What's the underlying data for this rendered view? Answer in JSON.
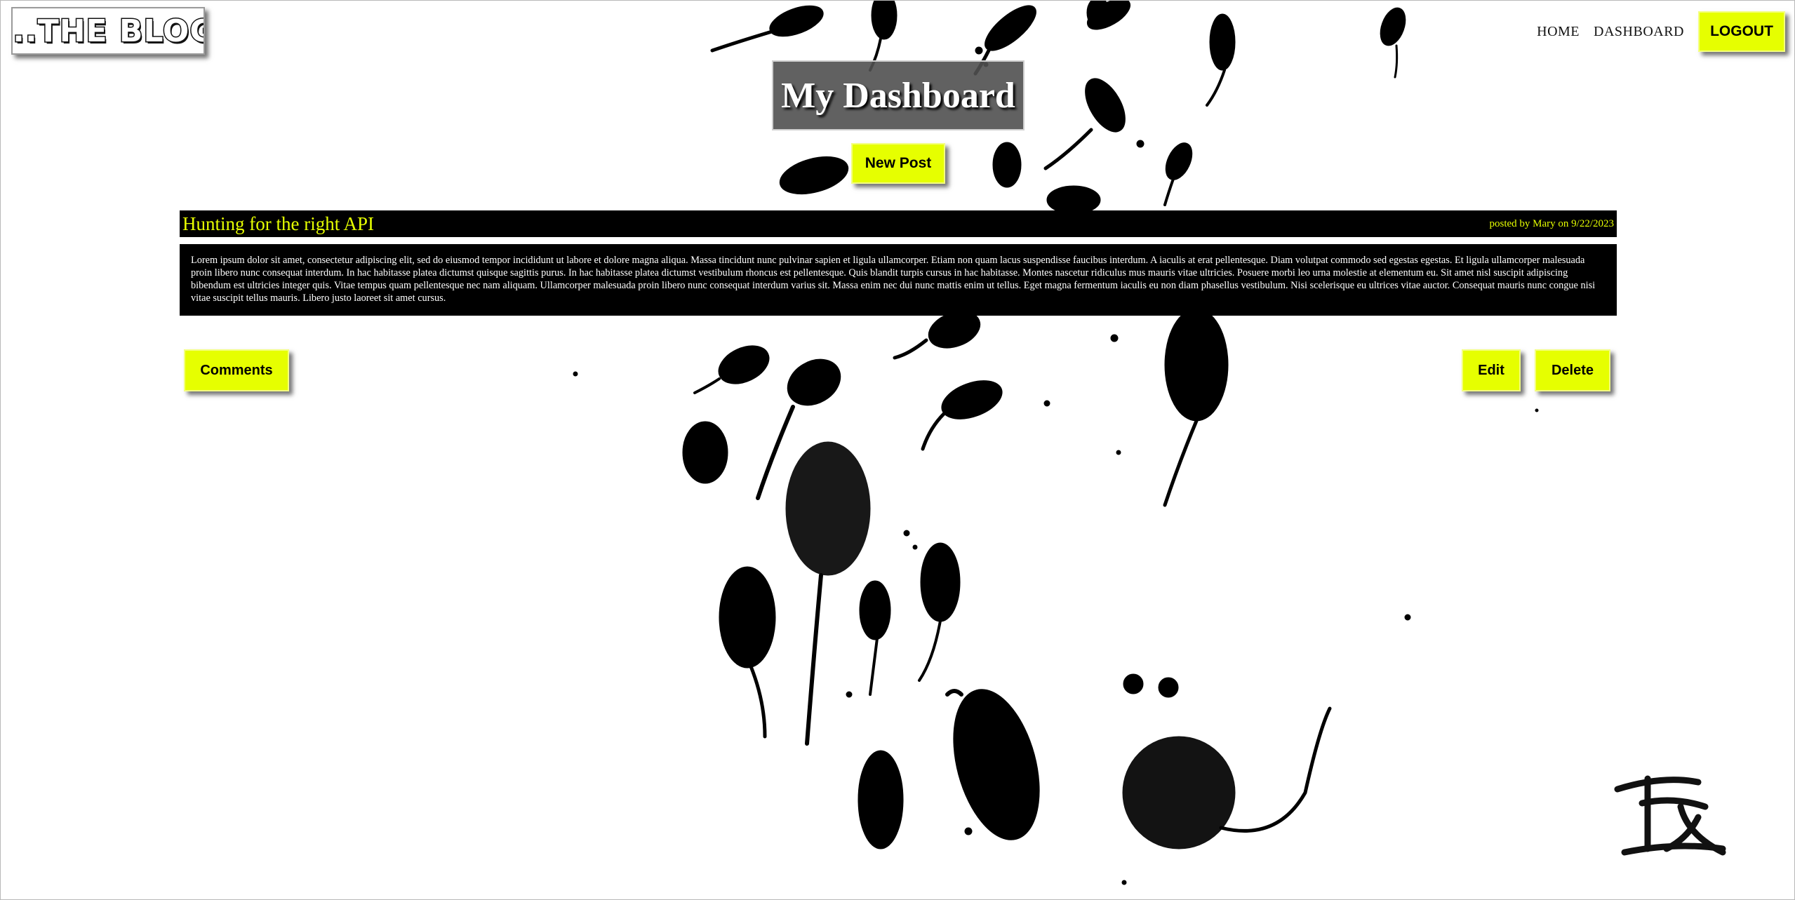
{
  "header": {
    "logo_text": "...THE BLOG",
    "nav": {
      "home": "HOME",
      "dashboard": "DASHBOARD",
      "logout": "LOGOUT"
    }
  },
  "dashboard": {
    "title": "My Dashboard",
    "new_post_label": "New Post"
  },
  "post": {
    "title": "Hunting for the right API",
    "meta": "posted by Mary on 9/22/2023",
    "body": "Lorem ipsum dolor sit amet, consectetur adipiscing elit, sed do eiusmod tempor incididunt ut labore et dolore magna aliqua. Massa tincidunt nunc pulvinar sapien et ligula ullamcorper. Etiam non quam lacus suspendisse faucibus interdum. A iaculis at erat pellentesque. Diam volutpat commodo sed egestas egestas. Et ligula ullamcorper malesuada proin libero nunc consequat interdum. In hac habitasse platea dictumst quisque sagittis purus. In hac habitasse platea dictumst vestibulum rhoncus est pellentesque. Quis blandit turpis cursus in hac habitasse. Montes nascetur ridiculus mus mauris vitae ultricies. Posuere morbi leo urna molestie at elementum eu. Sit amet nisl suscipit adipiscing bibendum est ultricies integer quis. Vitae tempus quam pellentesque nec nam aliquam. Ullamcorper malesuada proin libero nunc consequat interdum varius sit. Massa enim nec dui nunc mattis enim ut tellus. Eget magna fermentum iaculis eu non diam phasellus vestibulum. Nisi scelerisque eu ultrices vitae auctor. Consequat mauris nunc congue nisi vitae suscipit tellus mauris. Libero justo laoreet sit amet cursus.",
    "comments_label": "Comments",
    "edit_label": "Edit",
    "delete_label": "Delete"
  },
  "colors": {
    "accent": "#e6ff00",
    "post_background": "#000000",
    "title_box": "#505050"
  },
  "decor": {
    "background_art": "ink-mice-painting",
    "corner_mark": "ink-signature-seal"
  }
}
